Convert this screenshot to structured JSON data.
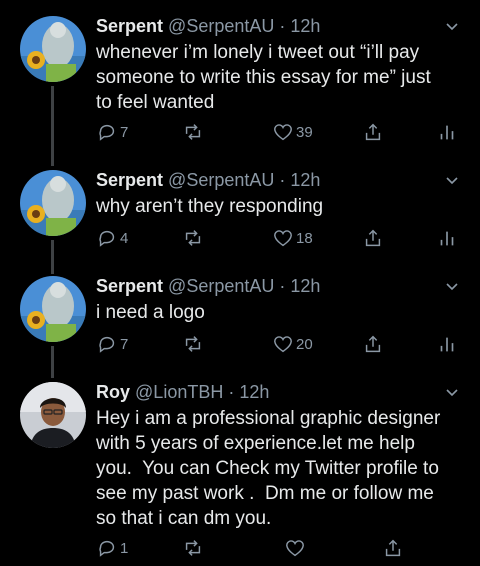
{
  "tweets": [
    {
      "name": "Serpent",
      "handle": "@SerpentAU",
      "time": "12h",
      "text": "whenever i’m lonely i tweet out “i’ll pay\nsomeone to write this essay for me” just\nto feel wanted",
      "replies": "7",
      "likes": "39",
      "avatar": "serpent-avatar"
    },
    {
      "name": "Serpent",
      "handle": "@SerpentAU",
      "time": "12h",
      "text": "why aren’t they responding",
      "replies": "4",
      "likes": "18",
      "avatar": "serpent-avatar"
    },
    {
      "name": "Serpent",
      "handle": "@SerpentAU",
      "time": "12h",
      "text": "i need a logo",
      "replies": "7",
      "likes": "20",
      "avatar": "serpent-avatar"
    },
    {
      "name": "Roy",
      "handle": "@LionTBH",
      "time": "12h",
      "text": "Hey i am a professional graphic designer\nwith 5 years of experience.let me help\nyou.  You can Check my Twitter profile to\nsee my past work .  Dm me or follow me\nso that i can dm you.",
      "replies": "1",
      "likes": "",
      "avatar": "roy-avatar"
    }
  ],
  "separator": "·",
  "colors": {
    "background": "#000000",
    "text": "#e7e9ea",
    "muted": "#8b98a5",
    "thread_line": "#3e4144"
  },
  "icons": [
    "reply-icon",
    "retweet-icon",
    "like-icon",
    "share-icon",
    "analytics-icon",
    "chevron-down-icon"
  ]
}
